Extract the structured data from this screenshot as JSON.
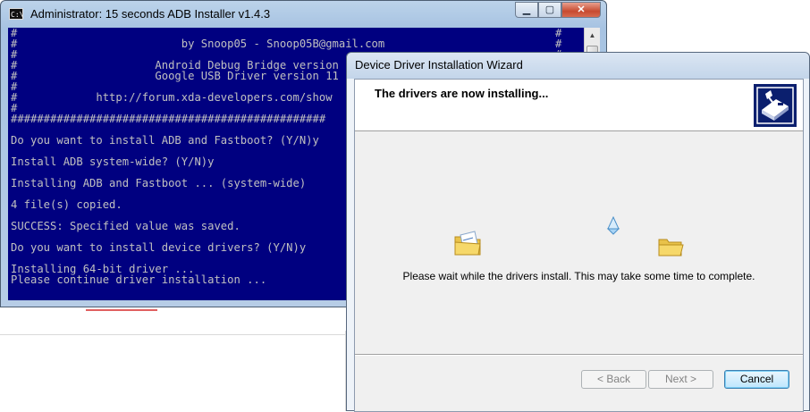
{
  "console": {
    "title": "Administrator:  15 seconds ADB Installer v1.4.3",
    "icon_label": "C:\\",
    "icon": "console-icon",
    "caption_buttons": {
      "minimize": "▁",
      "maximize": "▢",
      "close": "✕"
    },
    "lines": [
      "#                                                                                  #",
      "#                         by Snoop05 - Snoop05B@gmail.com                          #",
      "#                                                                                  #",
      "#                     Android Debug Bridge version",
      "#                     Google USB Driver version 11",
      "#",
      "#            http://forum.xda-developers.com/show",
      "#",
      "################################################",
      "",
      "Do you want to install ADB and Fastboot? (Y/N)y",
      "",
      "Install ADB system-wide? (Y/N)y",
      "",
      "Installing ADB and Fastboot ... (system-wide)",
      "",
      "4 file(s) copied.",
      "",
      "SUCCESS: Specified value was saved.",
      "",
      "Do you want to install device drivers? (Y/N)y",
      "",
      "Installing 64-bit driver ...",
      "Please continue driver installation ..."
    ],
    "colors": {
      "background": "#000080",
      "text": "#c0c0c0"
    }
  },
  "wizard": {
    "title": "Device Driver Installation Wizard",
    "heading": "The drivers are now installing...",
    "message": "Please wait while the drivers install. This may take some time to complete.",
    "buttons": {
      "back": "< Back",
      "next": "Next >",
      "cancel": "Cancel"
    },
    "icons": [
      "hardware-install-icon",
      "source-folder-icon",
      "flying-document-icon",
      "destination-folder-icon"
    ]
  }
}
